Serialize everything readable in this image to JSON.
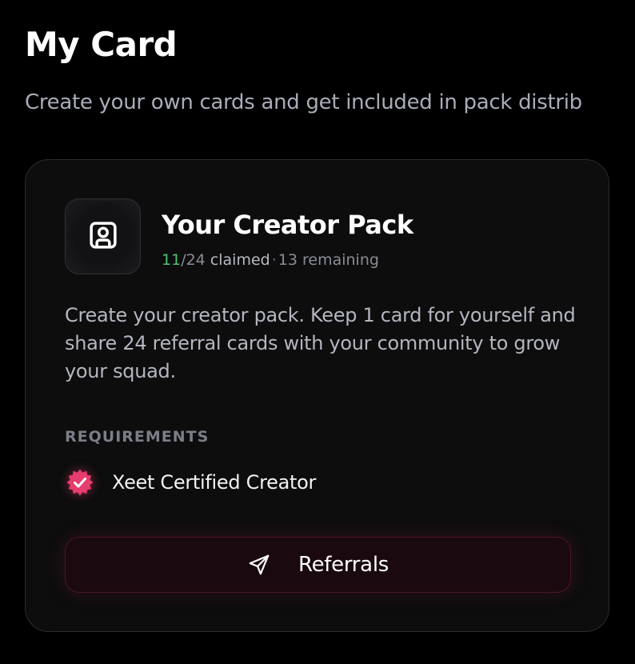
{
  "page": {
    "title": "My Card",
    "subtitle": "Create your own cards and get included in pack distrib"
  },
  "creator_pack": {
    "icon": "contact-card-icon",
    "title": "Your Creator Pack",
    "claimed": "11",
    "total": "/24",
    "claimed_label": "claimed",
    "separator": "·",
    "remaining": "13 remaining",
    "description": "Create your creator pack. Keep 1 card for yourself and share 24 referral cards with your community to grow your squad."
  },
  "requirements": {
    "heading": "REQUIREMENTS",
    "items": [
      {
        "label": "Xeet Certified Creator",
        "icon": "verified-badge-icon",
        "met": true
      }
    ]
  },
  "referrals_button": {
    "label": "Referrals",
    "icon": "send-icon"
  },
  "colors": {
    "background": "#000000",
    "card_background": "#0d0d0e",
    "accent_green": "#4cc46f",
    "accent_pink": "#e63c6e",
    "button_background": "#1a0a10",
    "button_border": "#4a1626"
  }
}
